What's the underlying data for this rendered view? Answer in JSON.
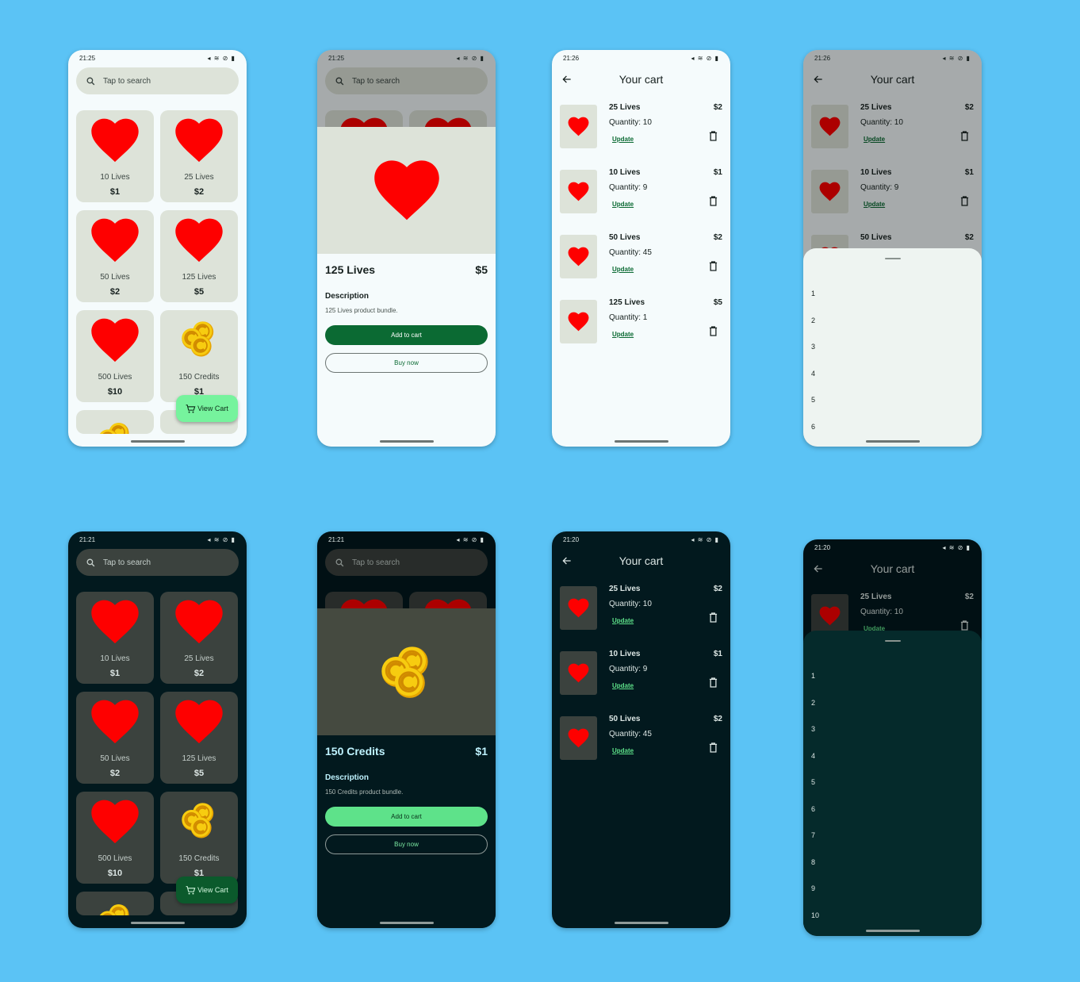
{
  "strings": {
    "search_placeholder": "Tap to search",
    "view_cart": "View Cart",
    "cart_title": "Your cart",
    "description_heading": "Description",
    "add_to_cart": "Add to cart",
    "buy_now": "Buy now",
    "update": "Update"
  },
  "colors": {
    "background": "#5bc3f5",
    "heart": "#fe0000",
    "coin": "#f2c40c",
    "primary_light": "#0b6a33",
    "primary_dark": "#5ee28a",
    "fab_light": "#76f39d",
    "fab_dark": "#0b5a2c"
  },
  "screens": {
    "s1": {
      "time": "21:25",
      "products": [
        {
          "name": "10 Lives",
          "price": "$1",
          "icon": "heart-icon"
        },
        {
          "name": "25 Lives",
          "price": "$2",
          "icon": "heart-icon"
        },
        {
          "name": "50 Lives",
          "price": "$2",
          "icon": "heart-icon"
        },
        {
          "name": "125 Lives",
          "price": "$5",
          "icon": "heart-icon"
        },
        {
          "name": "500 Lives",
          "price": "$10",
          "icon": "heart-icon"
        },
        {
          "name": "150 Credits",
          "price": "$1",
          "icon": "coins-icon"
        }
      ]
    },
    "s2": {
      "time": "21:25",
      "detail": {
        "name": "125 Lives",
        "price": "$5",
        "description": "125 Lives product bundle."
      }
    },
    "s3": {
      "time": "21:26",
      "items": [
        {
          "name": "25 Lives",
          "price": "$2",
          "quantity": "Quantity: 10"
        },
        {
          "name": "10 Lives",
          "price": "$1",
          "quantity": "Quantity: 9"
        },
        {
          "name": "50 Lives",
          "price": "$2",
          "quantity": "Quantity: 45"
        },
        {
          "name": "125 Lives",
          "price": "$5",
          "quantity": "Quantity: 1"
        }
      ]
    },
    "s4": {
      "time": "21:26",
      "items": [
        {
          "name": "25 Lives",
          "price": "$2",
          "quantity": "Quantity: 10"
        },
        {
          "name": "10 Lives",
          "price": "$1",
          "quantity": "Quantity: 9"
        },
        {
          "name": "50 Lives",
          "price": "$2"
        }
      ],
      "options": [
        "1",
        "2",
        "3",
        "4",
        "5",
        "6"
      ]
    },
    "s5": {
      "time": "21:21",
      "products": [
        {
          "name": "10 Lives",
          "price": "$1",
          "icon": "heart-icon"
        },
        {
          "name": "25 Lives",
          "price": "$2",
          "icon": "heart-icon"
        },
        {
          "name": "50 Lives",
          "price": "$2",
          "icon": "heart-icon"
        },
        {
          "name": "125 Lives",
          "price": "$5",
          "icon": "heart-icon"
        },
        {
          "name": "500 Lives",
          "price": "$10",
          "icon": "heart-icon"
        },
        {
          "name": "150 Credits",
          "price": "$1",
          "icon": "coins-icon"
        }
      ]
    },
    "s6": {
      "time": "21:21",
      "detail": {
        "name": "150 Credits",
        "price": "$1",
        "description": "150 Credits product bundle."
      }
    },
    "s7": {
      "time": "21:20",
      "items": [
        {
          "name": "25 Lives",
          "price": "$2",
          "quantity": "Quantity: 10"
        },
        {
          "name": "10 Lives",
          "price": "$1",
          "quantity": "Quantity: 9"
        },
        {
          "name": "50 Lives",
          "price": "$2",
          "quantity": "Quantity: 45"
        }
      ]
    },
    "s8": {
      "time": "21:20",
      "items": [
        {
          "name": "25 Lives",
          "price": "$2",
          "quantity": "Quantity: 10",
          "update_partial": "Update"
        }
      ],
      "options": [
        "1",
        "2",
        "3",
        "4",
        "5",
        "6",
        "7",
        "8",
        "9",
        "10"
      ]
    }
  }
}
